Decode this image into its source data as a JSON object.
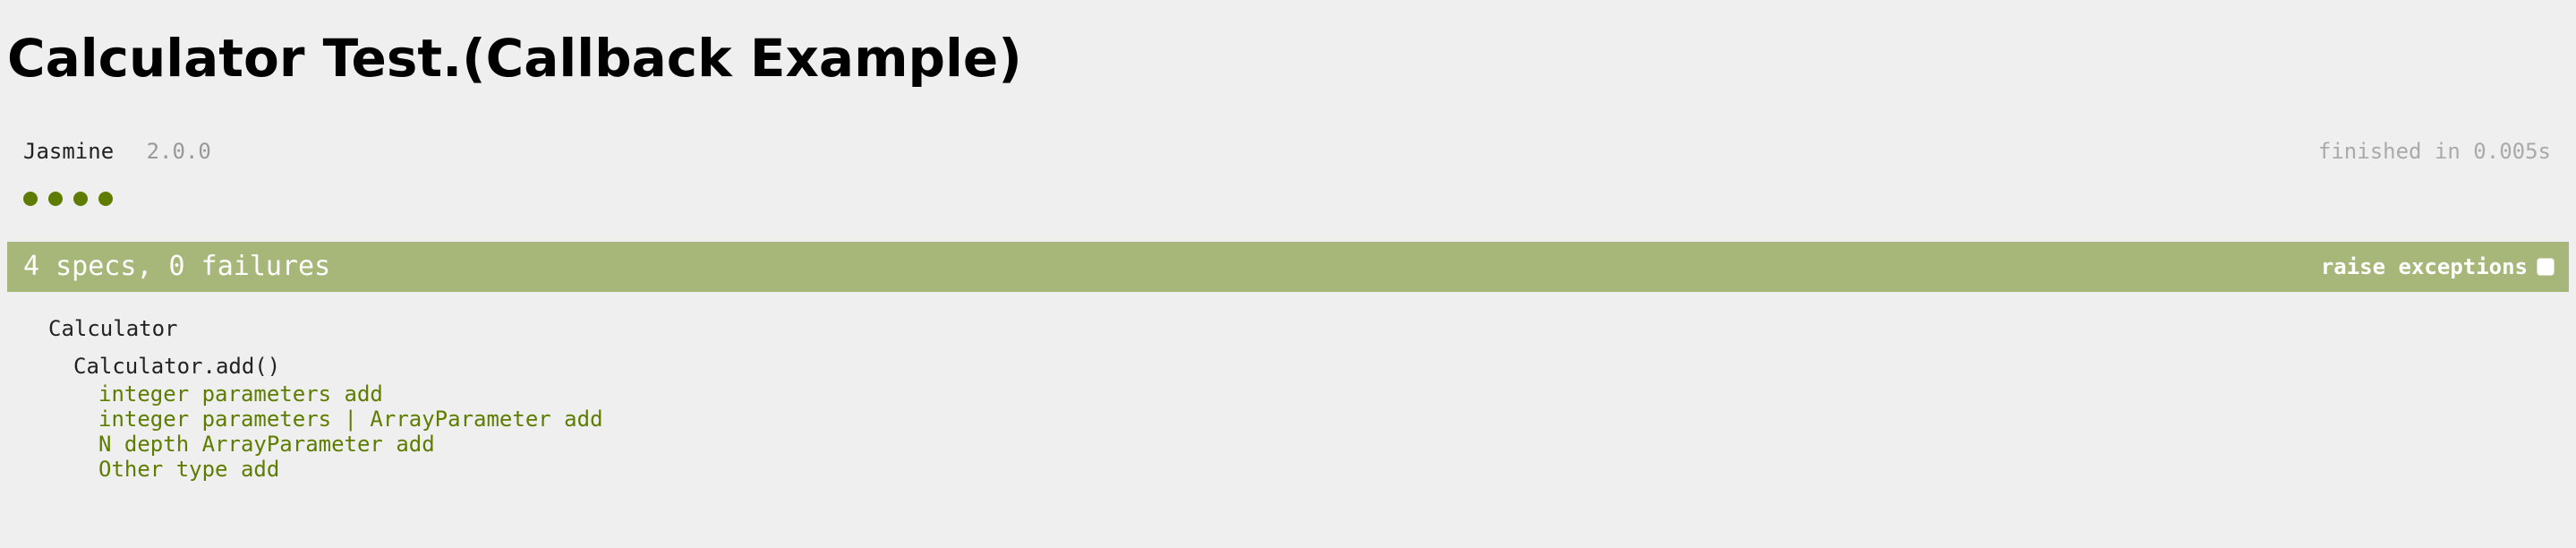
{
  "page_title": "Calculator Test.(Callback Example)",
  "banner": {
    "title": "Jasmine",
    "version": "2.0.0",
    "duration": "finished in 0.005s"
  },
  "symbol_summary": {
    "passed_count": 4,
    "passed_color": "#5e7d00"
  },
  "alert": {
    "overall": "4 specs, 0 failures",
    "bar_color": "#a6b779",
    "raise_exceptions_label": "raise exceptions",
    "raise_exceptions_checked": false
  },
  "results": {
    "suite": "Calculator",
    "sub_suite": "Calculator.add()",
    "specs": [
      "integer parameters add",
      "integer parameters | ArrayParameter add",
      "N depth ArrayParameter add",
      "Other type add"
    ]
  }
}
